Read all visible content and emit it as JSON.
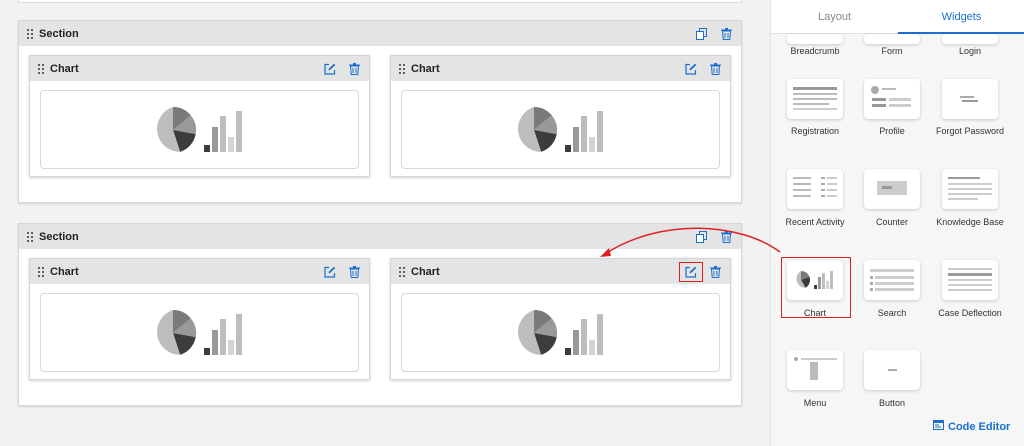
{
  "sections": [
    {
      "title": "Section",
      "widgets": [
        {
          "title": "Chart"
        },
        {
          "title": "Chart"
        }
      ]
    },
    {
      "title": "Section",
      "widgets": [
        {
          "title": "Chart"
        },
        {
          "title": "Chart"
        }
      ]
    }
  ],
  "panel": {
    "tabs": [
      {
        "label": "Layout",
        "active": false
      },
      {
        "label": "Widgets",
        "active": true
      }
    ],
    "widgets": [
      {
        "label": "Breadcrumb"
      },
      {
        "label": "Form"
      },
      {
        "label": "Login"
      },
      {
        "label": "Registration"
      },
      {
        "label": "Profile"
      },
      {
        "label": "Forgot Password"
      },
      {
        "label": "Recent Activity"
      },
      {
        "label": "Counter"
      },
      {
        "label": "Knowledge Base"
      },
      {
        "label": "Chart",
        "highlighted": true
      },
      {
        "label": "Search"
      },
      {
        "label": "Case Deflection"
      },
      {
        "label": "Menu"
      },
      {
        "label": "Button"
      }
    ],
    "code_editor_label": "Code Editor"
  },
  "colors": {
    "accent": "#1a6fd0",
    "highlight": "#e02020"
  }
}
